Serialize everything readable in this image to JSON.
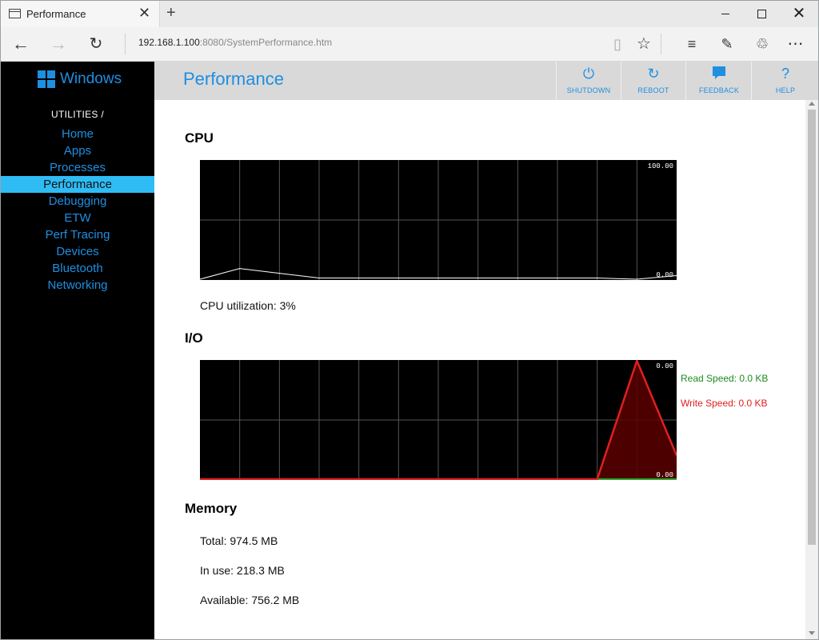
{
  "browser": {
    "tab_title": "Performance",
    "url_host": "192.168.1.100",
    "url_rest": ":8080/SystemPerformance.htm",
    "icons": [
      "tab-page-icon",
      "tab-close-icon",
      "new-tab-icon",
      "minimize-icon",
      "maximize-icon",
      "close-icon",
      "back-icon",
      "forward-icon",
      "refresh-icon",
      "reading-view-icon",
      "favorite-star-icon",
      "hub-icon",
      "web-note-icon",
      "share-icon",
      "more-icon"
    ]
  },
  "sidebar": {
    "logo_text": "Windows",
    "section_label": "UTILITIES /",
    "items": [
      {
        "label": "Home"
      },
      {
        "label": "Apps"
      },
      {
        "label": "Processes"
      },
      {
        "label": "Performance",
        "active": true
      },
      {
        "label": "Debugging"
      },
      {
        "label": "ETW"
      },
      {
        "label": "Perf Tracing"
      },
      {
        "label": "Devices"
      },
      {
        "label": "Bluetooth"
      },
      {
        "label": "Networking"
      }
    ]
  },
  "header": {
    "title": "Performance",
    "buttons": [
      {
        "label": "SHUTDOWN",
        "icon": "power-icon"
      },
      {
        "label": "REBOOT",
        "icon": "reboot-icon"
      },
      {
        "label": "FEEDBACK",
        "icon": "feedback-icon"
      },
      {
        "label": "HELP",
        "icon": "help-icon"
      }
    ]
  },
  "cpu": {
    "title": "CPU",
    "max_label": "100.00",
    "min_label": "0.00",
    "utilization_text": "CPU utilization: 3%"
  },
  "io": {
    "title": "I/O",
    "max_label": "0.00",
    "min_label": "0.00",
    "read_text": "Read Speed: 0.0 KB",
    "write_text": "Write Speed: 0.0 KB"
  },
  "memory": {
    "title": "Memory",
    "total_text": "Total: 974.5 MB",
    "in_use_text": "In use: 218.3 MB",
    "available_text": "Available: 756.2 MB"
  },
  "colors": {
    "accent": "#1e8fe1",
    "active_nav": "#2fbcf5",
    "cpu_line": "#ffffff",
    "io_write": "#e0201e",
    "io_write_fill": "#5a0000",
    "io_read": "#2fa82f"
  },
  "chart_data": [
    {
      "type": "line",
      "name": "cpu",
      "ylim": [
        0,
        100
      ],
      "x": [
        0,
        1,
        2,
        3,
        4,
        5,
        6,
        7,
        8,
        9,
        10,
        11,
        12
      ],
      "values": [
        0,
        9,
        5,
        1,
        1,
        1,
        1,
        1,
        1,
        1,
        1,
        0,
        3
      ]
    },
    {
      "type": "area",
      "name": "io",
      "ylim": [
        0,
        1
      ],
      "x": [
        0,
        1,
        2,
        3,
        4,
        5,
        6,
        7,
        8,
        9,
        10,
        11,
        12
      ],
      "series": [
        {
          "name": "Write Speed",
          "values": [
            0,
            0,
            0,
            0,
            0,
            0,
            0,
            0,
            0,
            0,
            0,
            1,
            0.2
          ]
        },
        {
          "name": "Read Speed",
          "values": [
            0,
            0,
            0,
            0,
            0,
            0,
            0,
            0,
            0,
            0,
            0,
            0,
            0
          ]
        }
      ]
    }
  ]
}
